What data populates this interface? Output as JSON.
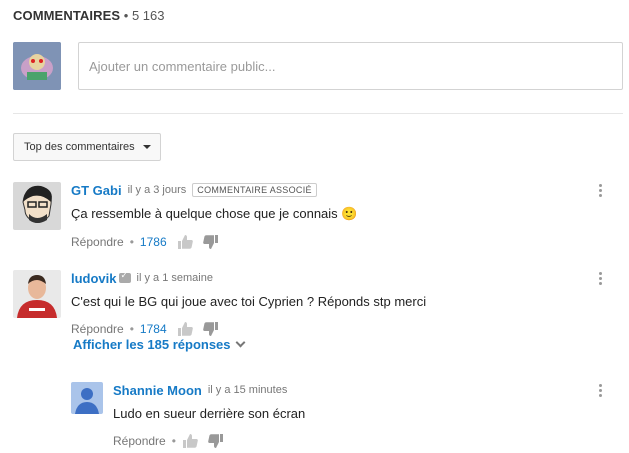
{
  "header": {
    "title": "COMMENTAIRES",
    "separator": "•",
    "count": "5 163"
  },
  "compose": {
    "placeholder": "Ajouter un commentaire public..."
  },
  "sort": {
    "label": "Top des commentaires"
  },
  "comments": [
    {
      "author": "GT Gabi",
      "time": "il y a 3 jours",
      "badge": "COMMENTAIRE ASSOCIÉ",
      "text": "Ça ressemble à quelque chose que je connais 🙂",
      "reply_label": "Répondre",
      "sep": "•",
      "likes": "1786"
    },
    {
      "author": "ludovik",
      "time": "il y a 1 semaine",
      "text": "C'est qui le BG qui joue avec toi Cyprien ? Réponds stp merci",
      "reply_label": "Répondre",
      "sep": "•",
      "likes": "1784",
      "show_replies": "Afficher les 185 réponses"
    }
  ],
  "reply": {
    "author": "Shannie Moon",
    "time": "il y a 15 minutes",
    "text": "Ludo en sueur derrière son écran",
    "reply_label": "Répondre",
    "sep": "•"
  },
  "colors": {
    "link": "#167ac6",
    "meta": "#767676"
  }
}
